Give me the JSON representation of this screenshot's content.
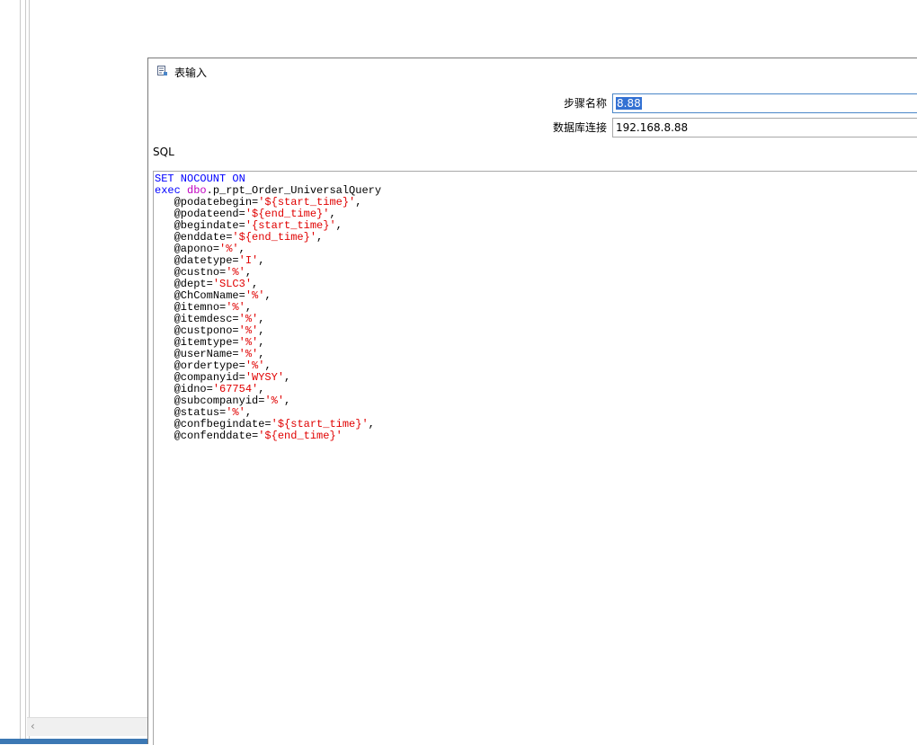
{
  "dialog": {
    "title": "表输入",
    "step_name_label": "步骤名称",
    "step_name_value": "8.88",
    "db_connection_label": "数据库连接",
    "db_connection_value": "192.168.8.88",
    "sql_label": "SQL"
  },
  "sql": {
    "line1": "SET NOCOUNT ON",
    "exec_kw": "exec",
    "exec_schema": "dbo",
    "exec_proc": ".p_rpt_Order_UniversalQuery",
    "params": [
      {
        "name": "@podatebegin=",
        "value": "'${start_time}'",
        "suffix": ","
      },
      {
        "name": "@podateend=",
        "value": "'${end_time}'",
        "suffix": ","
      },
      {
        "name": "@begindate=",
        "value": "'{start_time}'",
        "suffix": ","
      },
      {
        "name": "@enddate=",
        "value": "'${end_time}'",
        "suffix": ","
      },
      {
        "name": "@apono=",
        "value": "'%'",
        "suffix": ","
      },
      {
        "name": "@datetype=",
        "value": "'I'",
        "suffix": ","
      },
      {
        "name": "@custno=",
        "value": "'%'",
        "suffix": ","
      },
      {
        "name": "@dept=",
        "value": "'SLC3'",
        "suffix": ","
      },
      {
        "name": "@ChComName=",
        "value": "'%'",
        "suffix": ","
      },
      {
        "name": "@itemno=",
        "value": "'%'",
        "suffix": ","
      },
      {
        "name": "@itemdesc=",
        "value": "'%'",
        "suffix": ","
      },
      {
        "name": "@custpono=",
        "value": "'%'",
        "suffix": ","
      },
      {
        "name": "@itemtype=",
        "value": "'%'",
        "suffix": ","
      },
      {
        "name": "@userName=",
        "value": "'%'",
        "suffix": ","
      },
      {
        "name": "@ordertype=",
        "value": "'%'",
        "suffix": ","
      },
      {
        "name": "@companyid=",
        "value": "'WYSY'",
        "suffix": ","
      },
      {
        "name": "@idno=",
        "value": "'67754'",
        "suffix": ","
      },
      {
        "name": "@subcompanyid=",
        "value": "'%'",
        "suffix": ","
      },
      {
        "name": "@status=",
        "value": "'%'",
        "suffix": ","
      },
      {
        "name": "@confbegindate=",
        "value": "'${start_time}'",
        "suffix": ","
      },
      {
        "name": "@confenddate=",
        "value": "'${end_time}'",
        "suffix": ""
      }
    ]
  },
  "icons": {
    "title_icon": "table-input-icon",
    "scroll_left": "chevron-left-icon"
  },
  "colors": {
    "keyword": "#0000ff",
    "object": "#c000c0",
    "string": "#e00000",
    "selection": "#3371d3"
  }
}
